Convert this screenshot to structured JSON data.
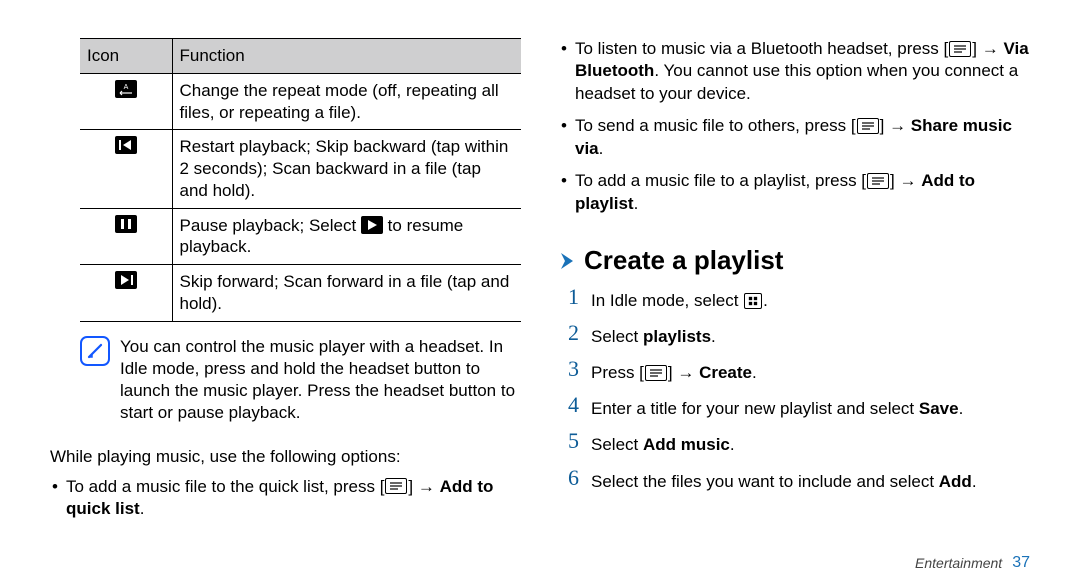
{
  "table": {
    "headers": {
      "icon": "Icon",
      "function": "Function"
    },
    "rows": [
      {
        "icon": "repeat-icon",
        "text": "Change the repeat mode (off, repeating all files, or repeating a file)."
      },
      {
        "icon": "prev-icon",
        "text": "Restart playback; Skip backward (tap within 2 seconds); Scan backward in a file (tap and hold)."
      },
      {
        "icon": "pause-icon",
        "text_before": "Pause playback; Select ",
        "text_after": " to resume playback.",
        "inline_icon": "play-icon"
      },
      {
        "icon": "next-icon",
        "text": "Skip forward; Scan forward in a file (tap and hold)."
      }
    ]
  },
  "note": "You can control the music player with a headset. In Idle mode, press and hold the headset button to launch the music player. Press the headset button to start or pause playback.",
  "left_para": "While playing music, use the following options:",
  "left_bullets": [
    {
      "pre": "To add a music file to the quick list, press [",
      "icon": "menu-icon",
      "mid": "] → ",
      "bold": "Add to quick list",
      "post": "."
    }
  ],
  "right_bullets": [
    {
      "pre": "To listen to music via a Bluetooth headset, press [",
      "icon": "menu-icon",
      "mid": "] → ",
      "bold": "Via Bluetooth",
      "post": ". You cannot use this option when you connect a headset to your device."
    },
    {
      "pre": "To send a music file to others, press [",
      "icon": "menu-icon",
      "mid": "] → ",
      "bold": "Share music via",
      "post": "."
    },
    {
      "pre": "To add a music file to a playlist, press [",
      "icon": "menu-icon",
      "mid": "] → ",
      "bold": "Add to playlist",
      "post": "."
    }
  ],
  "heading": "Create a playlist",
  "steps": [
    {
      "n": "1",
      "pre": "In Idle mode, select ",
      "icon": "apps-icon",
      "post": "."
    },
    {
      "n": "2",
      "pre": "Select ",
      "bold": "playlists",
      "post": "."
    },
    {
      "n": "3",
      "pre": "Press [",
      "icon": "menu-icon",
      "mid": "] → ",
      "bold": "Create",
      "post": "."
    },
    {
      "n": "4",
      "pre": "Enter a title for your new playlist and select ",
      "bold": "Save",
      "post": "."
    },
    {
      "n": "5",
      "pre": "Select ",
      "bold": "Add music",
      "post": "."
    },
    {
      "n": "6",
      "pre": "Select the files you want to include and select ",
      "bold": "Add",
      "post": "."
    }
  ],
  "footer": {
    "section": "Entertainment",
    "page": "37"
  }
}
